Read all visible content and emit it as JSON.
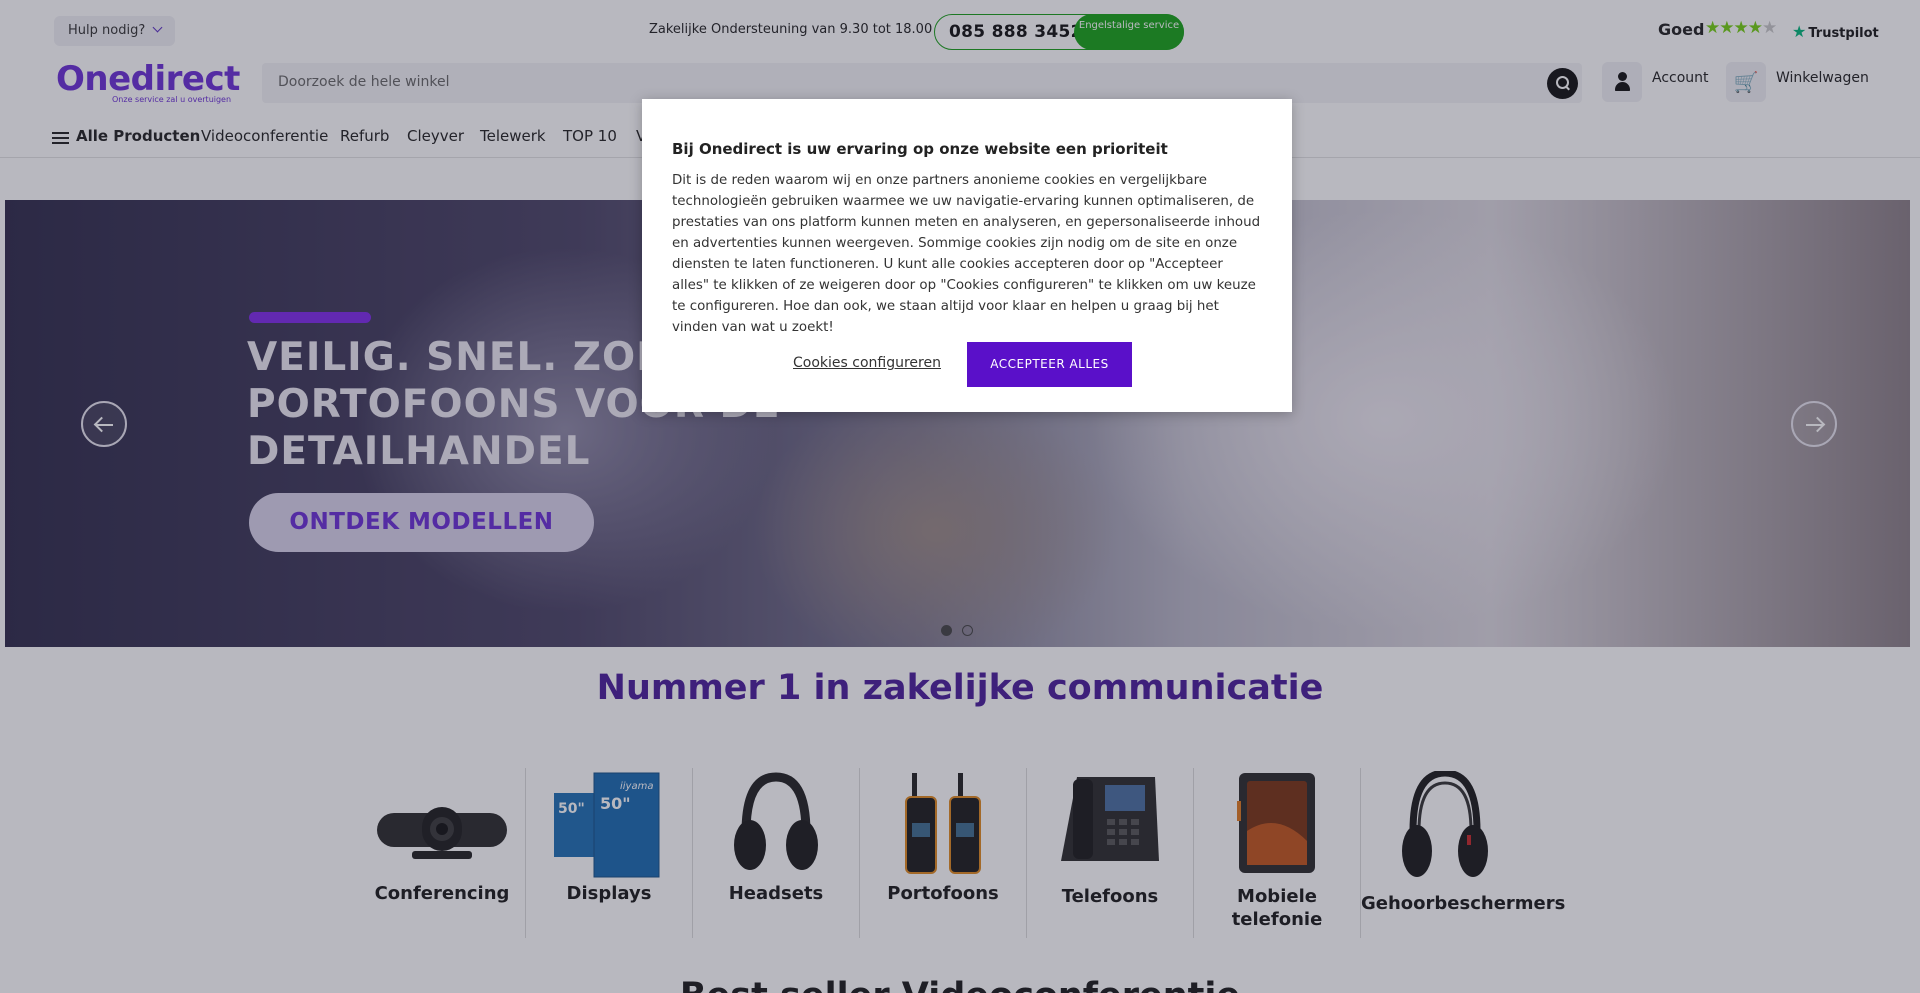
{
  "topbar": {
    "help_label": "Hulp nodig?",
    "support_text": "Zakelijke Ondersteuning van 9.30 tot 18.00 uur",
    "phone": "085 888 3452",
    "english_service": "Engelstalige service",
    "rating_word": "Goed",
    "rating_stars": "4.5 of 5",
    "trustpilot": "Trustpilot",
    "colors": {
      "phone_green": "#17a317",
      "trustpilot_green": "#00b67a"
    }
  },
  "header": {
    "logo_text": "Onedirect",
    "logo_tagline": "Onze service zal u overtuigen",
    "search_placeholder": "Doorzoek de hele winkel",
    "account_label": "Account",
    "cart_label": "Winkelwagen",
    "icons": [
      "search-icon",
      "account-icon",
      "cart-icon"
    ]
  },
  "nav": {
    "all_products": "Alle Producten",
    "items": [
      "Videoconferentie",
      "Refurb",
      "Cleyver",
      "Telewerk",
      "TOP 10",
      "V"
    ]
  },
  "hero": {
    "headline": "VEILIG. SNEL. ZOE PORTOFOONS VOOR DE DETAILHANDEL",
    "cta": "ONTDEK MODELLEN",
    "active_slide": 1,
    "slide_count": 2,
    "colors": {
      "accent": "#7f2bea"
    }
  },
  "main": {
    "headline": "Nummer 1 in zakelijke communicatie",
    "categories": [
      {
        "label": "Conferencing",
        "icon": "conference-camera-icon"
      },
      {
        "label": "Displays",
        "icon": "display-icon",
        "badge": "50\""
      },
      {
        "label": "Headsets",
        "icon": "headset-icon"
      },
      {
        "label": "Portofoons",
        "icon": "walkie-talkie-icon"
      },
      {
        "label": "Telefoons",
        "icon": "desk-phone-icon"
      },
      {
        "label": "Mobiele telefonie",
        "icon": "mobile-phone-icon"
      },
      {
        "label": "Gehoorbeschermers",
        "icon": "ear-protector-icon"
      }
    ],
    "next_section_title": "Best seller Videoconferentie"
  },
  "cookie_modal": {
    "title": "Bij Onedirect is uw ervaring op onze website een prioriteit",
    "body": "Dit is de reden waarom wij en onze partners anonieme cookies en vergelijkbare technologieën gebruiken waarmee we uw navigatie-ervaring kunnen optimaliseren, de prestaties van ons platform kunnen meten en analyseren, en gepersonaliseerde inhoud en advertenties kunnen weergeven. Sommige cookies zijn nodig om de site en onze diensten te laten functioneren. U kunt alle cookies accepteren door op \"Accepteer alles\" te klikken of ze weigeren door op \"Cookies configureren\" te klikken om uw keuze te configureren. Hoe dan ook, we staan altijd voor klaar en helpen u graag bij het vinden van wat u zoekt!",
    "configure_label": "Cookies configureren",
    "accept_label": "ACCEPTEER ALLES",
    "colors": {
      "accept_bg": "#5a10c9"
    }
  }
}
